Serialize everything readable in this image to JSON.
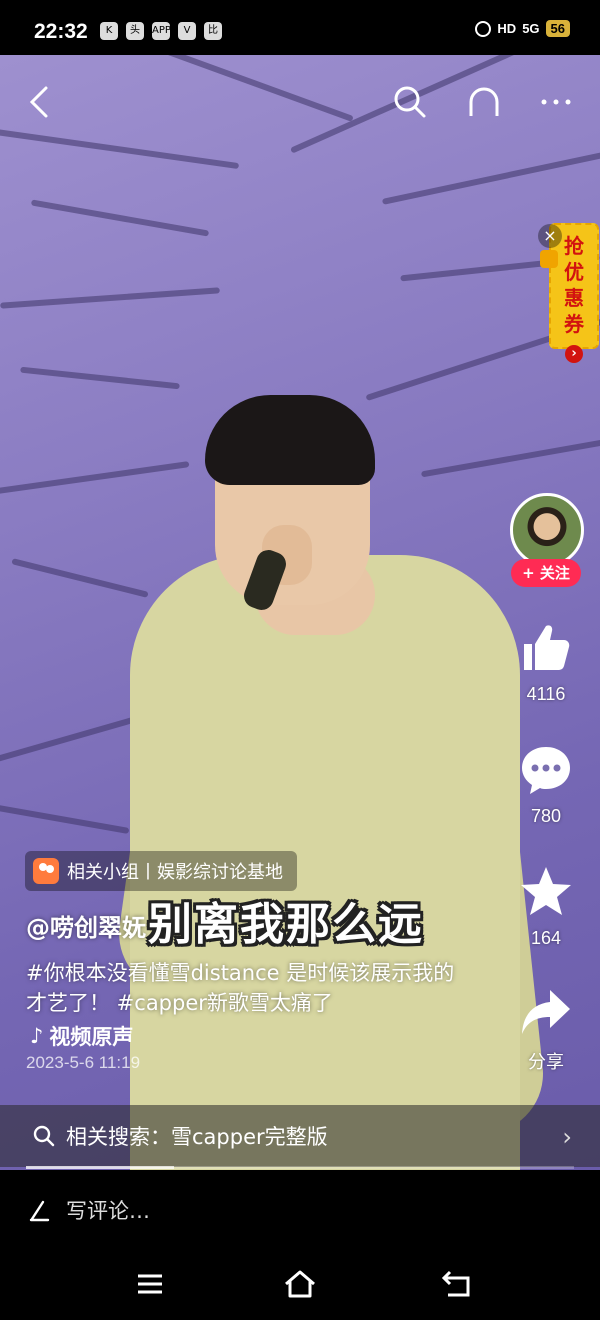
{
  "status_bar": {
    "time": "22:32",
    "left_icons": [
      "K",
      "头条",
      "APP",
      "V",
      "比"
    ],
    "right_icons": [
      "alarm-icon",
      "HD",
      "5G"
    ],
    "battery": "56"
  },
  "top_bar": {
    "icons": [
      "back-icon",
      "search-icon",
      "headset-icon",
      "more-icon"
    ]
  },
  "coupon": {
    "text": "抢优惠券",
    "arrow": "›"
  },
  "author_panel": {
    "follow_label": "+ 关注"
  },
  "actions": {
    "like_count": "4116",
    "comment_count": "780",
    "favorite_count": "164",
    "share_label": "分享"
  },
  "group_tag": {
    "label": "相关小组丨娱影综讨论基地"
  },
  "video": {
    "author": "@唠创翠妩",
    "subtitle": "别离我那么远",
    "description": "#你根本没看懂雪distance 是时候该展示我的才艺了！ #capper新歌雪太痛了",
    "music": "视频原声",
    "date": "2023-5-6 11:19",
    "progress": 0.27
  },
  "related_search": {
    "label": "相关搜索：雪capper完整版"
  },
  "comment_input": {
    "placeholder": "写评论…"
  },
  "colors": {
    "follow": "#ff2b54",
    "coupon_bg": "#f5c418",
    "coupon_text": "#d2130f"
  }
}
